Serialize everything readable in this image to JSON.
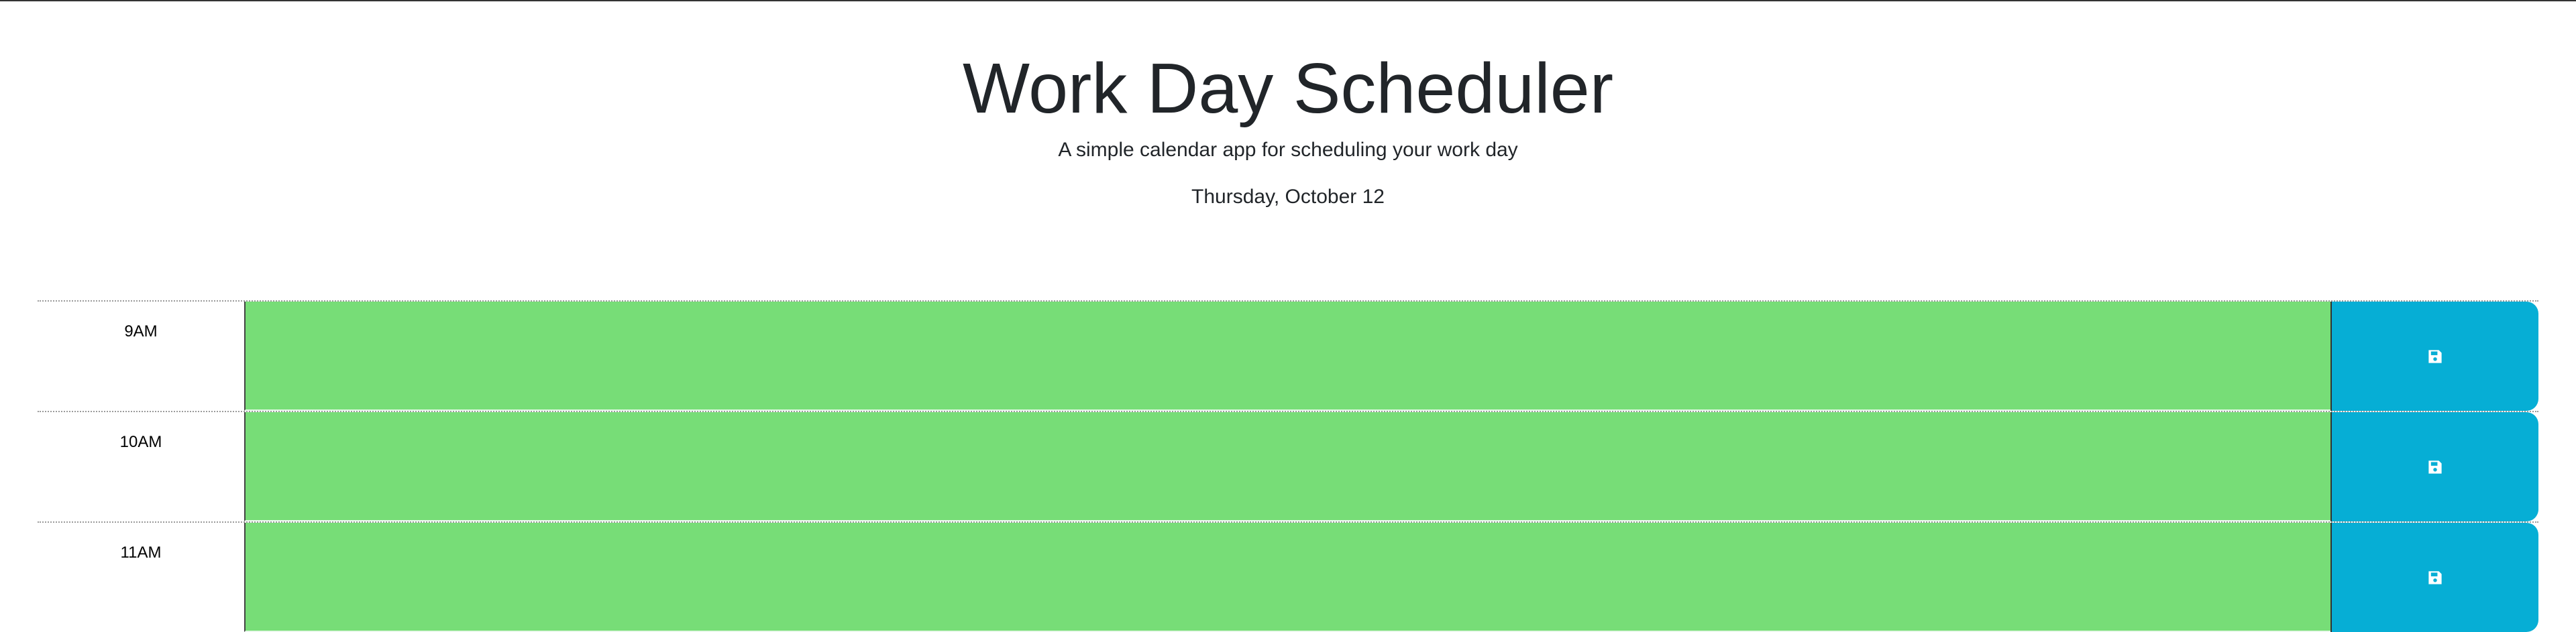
{
  "header": {
    "title": "Work Day Scheduler",
    "lead": "A simple calendar app for scheduling your work day",
    "current_day": "Thursday, October 12"
  },
  "time_blocks": [
    {
      "hour": "9AM",
      "description": "",
      "state": "future",
      "save_icon": "floppy-disk-icon"
    },
    {
      "hour": "10AM",
      "description": "",
      "state": "future",
      "save_icon": "floppy-disk-icon"
    },
    {
      "hour": "11AM",
      "description": "",
      "state": "future",
      "save_icon": "floppy-disk-icon"
    }
  ],
  "colors": {
    "future": "#77dd77",
    "save_button": "#06aed5",
    "text": "#212529"
  }
}
